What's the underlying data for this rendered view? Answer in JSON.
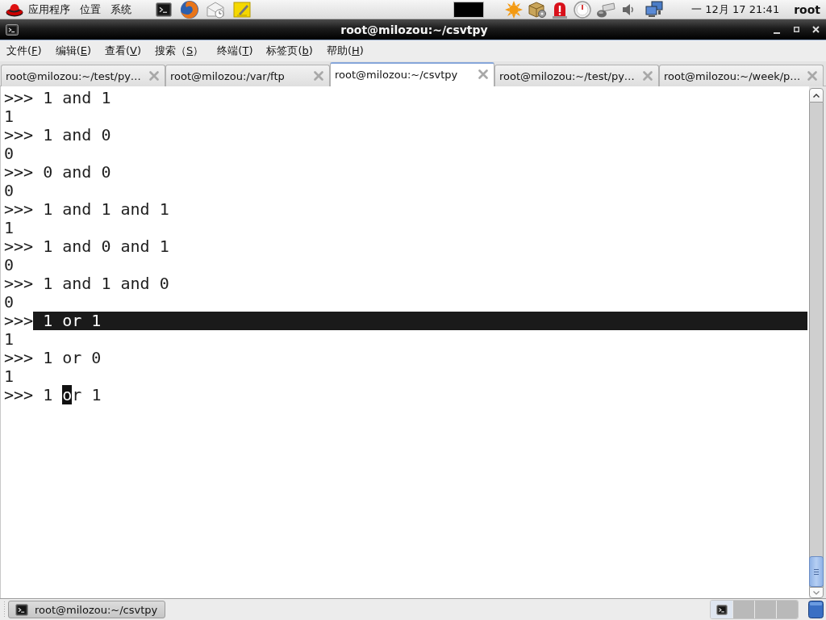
{
  "top_panel": {
    "menus": [
      "应用程序",
      "位置",
      "系统"
    ],
    "clock": "一 12月 17 21:41",
    "user": "root"
  },
  "window": {
    "title": "root@milozou:~/csvtpy"
  },
  "menu_bar": [
    {
      "before": "文件(",
      "key": "F",
      "after": ")"
    },
    {
      "before": "编辑(",
      "key": "E",
      "after": ")"
    },
    {
      "before": "查看(",
      "key": "V",
      "after": ")"
    },
    {
      "before": "搜索（",
      "key": "S",
      "after": "）"
    },
    {
      "before": "终端(",
      "key": "T",
      "after": ")"
    },
    {
      "before": "标签页(",
      "key": "b",
      "after": ")"
    },
    {
      "before": "帮助(",
      "key": "H",
      "after": ")"
    }
  ],
  "tabs": [
    {
      "label": "root@milozou:~/test/py…",
      "selected": false
    },
    {
      "label": "root@milozou:/var/ftp",
      "selected": false
    },
    {
      "label": "root@milozou:~/csvtpy",
      "selected": true
    },
    {
      "label": "root@milozou:~/test/py…",
      "selected": false
    },
    {
      "label": "root@milozou:~/week/p…",
      "selected": false
    }
  ],
  "terminal": {
    "lines": [
      {
        "kind": "input",
        "prompt": ">>>",
        "code": "1 and 1",
        "selected": false
      },
      {
        "kind": "output",
        "text": "1",
        "selected": false
      },
      {
        "kind": "input",
        "prompt": ">>>",
        "code": "1 and 0",
        "selected": false
      },
      {
        "kind": "output",
        "text": "0",
        "selected": false
      },
      {
        "kind": "input",
        "prompt": ">>>",
        "code": "0 and 0",
        "selected": false
      },
      {
        "kind": "output",
        "text": "0",
        "selected": false
      },
      {
        "kind": "input",
        "prompt": ">>>",
        "code": "1 and 1 and 1",
        "selected": false
      },
      {
        "kind": "output",
        "text": "1",
        "selected": false
      },
      {
        "kind": "input",
        "prompt": ">>>",
        "code": "1 and 0 and 1",
        "selected": false
      },
      {
        "kind": "output",
        "text": "0",
        "selected": false
      },
      {
        "kind": "input",
        "prompt": ">>>",
        "code": "1 and 1 and 0",
        "selected": false
      },
      {
        "kind": "output",
        "text": "0",
        "selected": false
      },
      {
        "kind": "input",
        "prompt": ">>>",
        "code": "1 or 1",
        "selected": true
      },
      {
        "kind": "output",
        "text": "1",
        "selected": false
      },
      {
        "kind": "input",
        "prompt": ">>>",
        "code": "1 or 0",
        "selected": false
      },
      {
        "kind": "output",
        "text": "1",
        "selected": false
      },
      {
        "kind": "input",
        "prompt": ">>>",
        "code": "1 ",
        "cursor": "o",
        "code_after_cursor": "r 1",
        "selected": false
      }
    ]
  },
  "taskbar": {
    "windows": [
      {
        "label": "root@milozou:~/csvtpy"
      }
    ],
    "workspaces": [
      {
        "selected": true
      },
      {
        "selected": false
      },
      {
        "selected": false
      },
      {
        "selected": false
      }
    ]
  }
}
